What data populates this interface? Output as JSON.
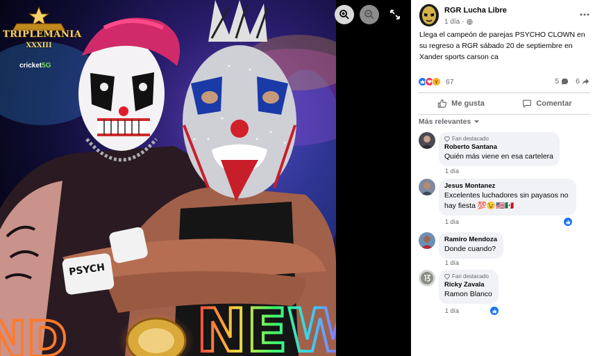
{
  "viewer": {
    "zoom_in_icon": "zoom-in-icon",
    "zoom_out_icon": "zoom-out-icon",
    "fullscreen_icon": "expand-icon",
    "image": {
      "logo_word": "TRIPLEMANIA",
      "logo_number": "XXXIII",
      "sponsor_brand": "cricket",
      "sponsor_suffix": "5G",
      "banner_text": "NEW"
    }
  },
  "post": {
    "page_name": "RGR Lucha Libre",
    "time": "1 día",
    "privacy_icon": "globe-icon",
    "more_icon": "more-options-icon",
    "text": "Llega el campeón de parejas PSYCHO CLOWN en su regreso a RGR sábado 20 de septiembre en Xander sports carson ca",
    "reaction_count": "67",
    "comment_count": "5",
    "share_count": "6",
    "like_label": "Me gusta",
    "comment_label": "Comentar",
    "sort_label": "Más relevantes"
  },
  "comments": [
    {
      "badge": "Fan destacado",
      "name": "Roberto Santana",
      "text": "Quién más viene en esa cartelera",
      "time": "1 día",
      "liked": false
    },
    {
      "badge": "",
      "name": "Jesus Montanez",
      "text": "Excelentes luchadores sin payasos no hay fiesta 💯😉🇺🇸🇲🇽",
      "time": "1 día",
      "liked": true
    },
    {
      "badge": "",
      "name": "Ramiro Mendoza",
      "text": "Donde cuando?",
      "time": "1 día",
      "liked": false
    },
    {
      "badge": "Fan destacado",
      "name": "Ricky Zavala",
      "text": "Ramon Blanco",
      "time": "1 día",
      "liked": true
    }
  ],
  "colors": {
    "accent": "#1877f2",
    "secondary_text": "#65676b",
    "bubble": "#f0f2f5",
    "love": "#f33e58",
    "wow": "#f7b125"
  }
}
